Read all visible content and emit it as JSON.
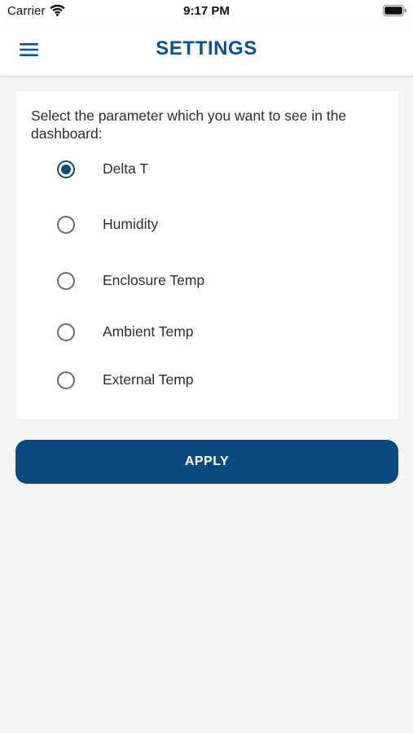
{
  "status_bar": {
    "carrier": "Carrier",
    "time": "9:17 PM",
    "icons": [
      "wifi-icon",
      "battery-icon"
    ]
  },
  "header": {
    "title": "SETTINGS",
    "menu_icon": "hamburger-menu-icon"
  },
  "settings": {
    "prompt": "Select the parameter which you want to see in the dashboard:",
    "options": [
      {
        "label": "Delta T",
        "selected": true
      },
      {
        "label": "Humidity",
        "selected": false
      },
      {
        "label": "Enclosure Temp",
        "selected": false
      },
      {
        "label": "Ambient Temp",
        "selected": false
      },
      {
        "label": "External Temp",
        "selected": false
      }
    ]
  },
  "actions": {
    "apply_label": "APPLY"
  },
  "colors": {
    "brand": "#0d5290",
    "button": "#0b4a80",
    "background": "#f4f4f4",
    "card": "#ffffff"
  }
}
